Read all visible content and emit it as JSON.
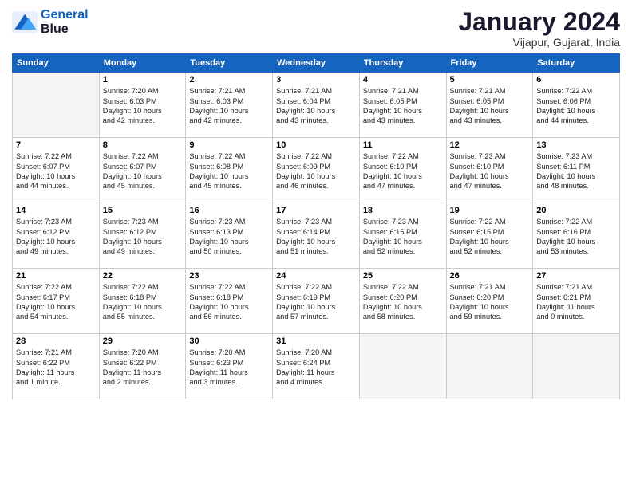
{
  "header": {
    "logo_line1": "General",
    "logo_line2": "Blue",
    "title": "January 2024",
    "subtitle": "Vijapur, Gujarat, India"
  },
  "weekdays": [
    "Sunday",
    "Monday",
    "Tuesday",
    "Wednesday",
    "Thursday",
    "Friday",
    "Saturday"
  ],
  "weeks": [
    [
      {
        "num": "",
        "info": ""
      },
      {
        "num": "1",
        "info": "Sunrise: 7:20 AM\nSunset: 6:03 PM\nDaylight: 10 hours\nand 42 minutes."
      },
      {
        "num": "2",
        "info": "Sunrise: 7:21 AM\nSunset: 6:03 PM\nDaylight: 10 hours\nand 42 minutes."
      },
      {
        "num": "3",
        "info": "Sunrise: 7:21 AM\nSunset: 6:04 PM\nDaylight: 10 hours\nand 43 minutes."
      },
      {
        "num": "4",
        "info": "Sunrise: 7:21 AM\nSunset: 6:05 PM\nDaylight: 10 hours\nand 43 minutes."
      },
      {
        "num": "5",
        "info": "Sunrise: 7:21 AM\nSunset: 6:05 PM\nDaylight: 10 hours\nand 43 minutes."
      },
      {
        "num": "6",
        "info": "Sunrise: 7:22 AM\nSunset: 6:06 PM\nDaylight: 10 hours\nand 44 minutes."
      }
    ],
    [
      {
        "num": "7",
        "info": "Sunrise: 7:22 AM\nSunset: 6:07 PM\nDaylight: 10 hours\nand 44 minutes."
      },
      {
        "num": "8",
        "info": "Sunrise: 7:22 AM\nSunset: 6:07 PM\nDaylight: 10 hours\nand 45 minutes."
      },
      {
        "num": "9",
        "info": "Sunrise: 7:22 AM\nSunset: 6:08 PM\nDaylight: 10 hours\nand 45 minutes."
      },
      {
        "num": "10",
        "info": "Sunrise: 7:22 AM\nSunset: 6:09 PM\nDaylight: 10 hours\nand 46 minutes."
      },
      {
        "num": "11",
        "info": "Sunrise: 7:22 AM\nSunset: 6:10 PM\nDaylight: 10 hours\nand 47 minutes."
      },
      {
        "num": "12",
        "info": "Sunrise: 7:23 AM\nSunset: 6:10 PM\nDaylight: 10 hours\nand 47 minutes."
      },
      {
        "num": "13",
        "info": "Sunrise: 7:23 AM\nSunset: 6:11 PM\nDaylight: 10 hours\nand 48 minutes."
      }
    ],
    [
      {
        "num": "14",
        "info": "Sunrise: 7:23 AM\nSunset: 6:12 PM\nDaylight: 10 hours\nand 49 minutes."
      },
      {
        "num": "15",
        "info": "Sunrise: 7:23 AM\nSunset: 6:12 PM\nDaylight: 10 hours\nand 49 minutes."
      },
      {
        "num": "16",
        "info": "Sunrise: 7:23 AM\nSunset: 6:13 PM\nDaylight: 10 hours\nand 50 minutes."
      },
      {
        "num": "17",
        "info": "Sunrise: 7:23 AM\nSunset: 6:14 PM\nDaylight: 10 hours\nand 51 minutes."
      },
      {
        "num": "18",
        "info": "Sunrise: 7:23 AM\nSunset: 6:15 PM\nDaylight: 10 hours\nand 52 minutes."
      },
      {
        "num": "19",
        "info": "Sunrise: 7:22 AM\nSunset: 6:15 PM\nDaylight: 10 hours\nand 52 minutes."
      },
      {
        "num": "20",
        "info": "Sunrise: 7:22 AM\nSunset: 6:16 PM\nDaylight: 10 hours\nand 53 minutes."
      }
    ],
    [
      {
        "num": "21",
        "info": "Sunrise: 7:22 AM\nSunset: 6:17 PM\nDaylight: 10 hours\nand 54 minutes."
      },
      {
        "num": "22",
        "info": "Sunrise: 7:22 AM\nSunset: 6:18 PM\nDaylight: 10 hours\nand 55 minutes."
      },
      {
        "num": "23",
        "info": "Sunrise: 7:22 AM\nSunset: 6:18 PM\nDaylight: 10 hours\nand 56 minutes."
      },
      {
        "num": "24",
        "info": "Sunrise: 7:22 AM\nSunset: 6:19 PM\nDaylight: 10 hours\nand 57 minutes."
      },
      {
        "num": "25",
        "info": "Sunrise: 7:22 AM\nSunset: 6:20 PM\nDaylight: 10 hours\nand 58 minutes."
      },
      {
        "num": "26",
        "info": "Sunrise: 7:21 AM\nSunset: 6:20 PM\nDaylight: 10 hours\nand 59 minutes."
      },
      {
        "num": "27",
        "info": "Sunrise: 7:21 AM\nSunset: 6:21 PM\nDaylight: 11 hours\nand 0 minutes."
      }
    ],
    [
      {
        "num": "28",
        "info": "Sunrise: 7:21 AM\nSunset: 6:22 PM\nDaylight: 11 hours\nand 1 minute."
      },
      {
        "num": "29",
        "info": "Sunrise: 7:20 AM\nSunset: 6:22 PM\nDaylight: 11 hours\nand 2 minutes."
      },
      {
        "num": "30",
        "info": "Sunrise: 7:20 AM\nSunset: 6:23 PM\nDaylight: 11 hours\nand 3 minutes."
      },
      {
        "num": "31",
        "info": "Sunrise: 7:20 AM\nSunset: 6:24 PM\nDaylight: 11 hours\nand 4 minutes."
      },
      {
        "num": "",
        "info": ""
      },
      {
        "num": "",
        "info": ""
      },
      {
        "num": "",
        "info": ""
      }
    ]
  ]
}
